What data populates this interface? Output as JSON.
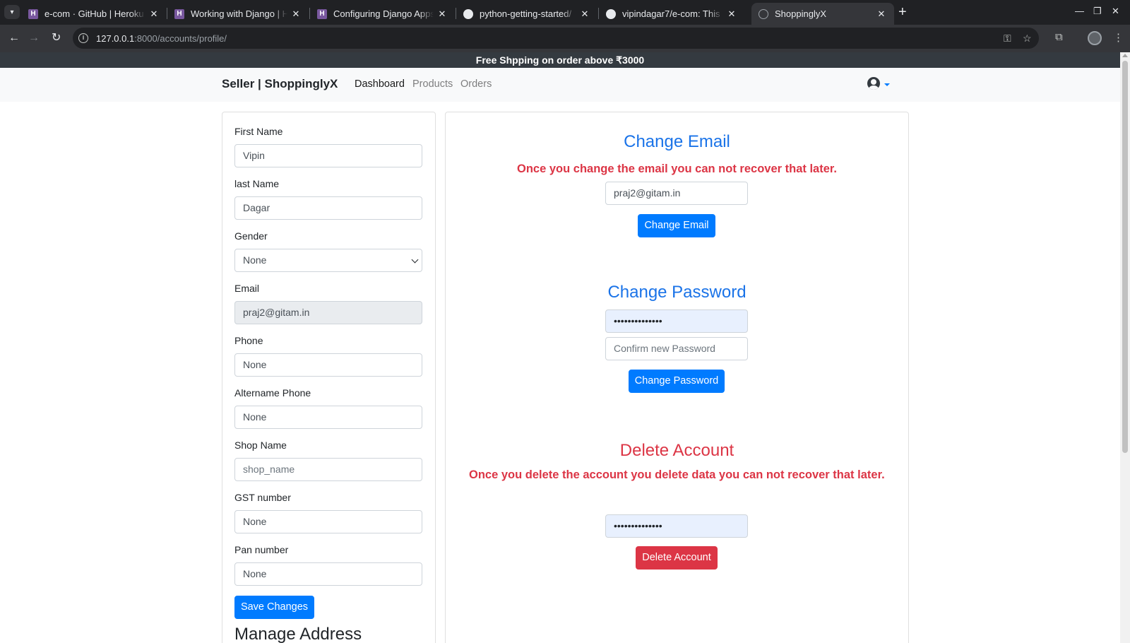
{
  "browser": {
    "tabs": [
      {
        "title": "e-com · GitHub | Heroku",
        "favicon": "heroku-icon"
      },
      {
        "title": "Working with Django | Heroku",
        "favicon": "heroku-icon"
      },
      {
        "title": "Configuring Django Apps for Heroku",
        "favicon": "heroku-icon"
      },
      {
        "title": "python-getting-started/",
        "favicon": "github-icon"
      },
      {
        "title": "vipindagar7/e-com: This",
        "favicon": "github-icon"
      },
      {
        "title": "ShoppinglyX",
        "favicon": "globe-icon",
        "active": true
      }
    ],
    "url_host": "127.0.0.1",
    "url_path": ":8000/accounts/profile/"
  },
  "promo": {
    "text": "Free Shpping on order above ₹3000"
  },
  "navbar": {
    "brand": "Seller | ShoppinglyX",
    "links": [
      "Dashboard",
      "Products",
      "Orders"
    ]
  },
  "profile_form": {
    "first_name": {
      "label": "First Name",
      "value": "Vipin"
    },
    "last_name": {
      "label": "last Name",
      "value": "Dagar"
    },
    "gender": {
      "label": "Gender",
      "value": "None"
    },
    "email": {
      "label": "Email",
      "value": "praj2@gitam.in"
    },
    "phone": {
      "label": "Phone",
      "value": "None"
    },
    "alt_phone": {
      "label": "Altername Phone",
      "value": "None"
    },
    "shop_name": {
      "label": "Shop Name",
      "placeholder": "shop_name"
    },
    "gst": {
      "label": "GST number",
      "value": "None"
    },
    "pan": {
      "label": "Pan number",
      "value": "None"
    },
    "save_label": "Save Changes",
    "manage_address": "Manage Address"
  },
  "change_email": {
    "title": "Change Email",
    "warning": "Once you change the email you can not recover that later.",
    "value": "praj2@gitam.in",
    "button": "Change Email"
  },
  "change_password": {
    "title": "Change Password",
    "masked_value": "••••••••••••••",
    "confirm_placeholder": "Confirm new Password",
    "button": "Change Password"
  },
  "delete_account": {
    "title": "Delete Account",
    "warning": "Once you delete the account you delete data you can not recover that later.",
    "masked_value": "••••••••••••••",
    "button": "Delete Account"
  },
  "colors": {
    "primary": "#007bff",
    "danger": "#dc3545",
    "heading_blue": "#1a73e8"
  }
}
